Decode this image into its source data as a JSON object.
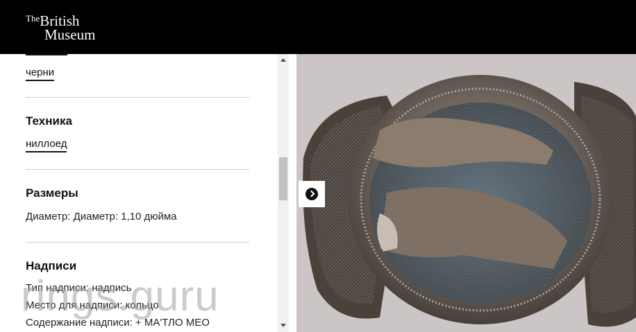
{
  "header": {
    "logo_the": "The",
    "logo_british": "British",
    "logo_museum": "Museum",
    "bg": "#000000"
  },
  "details": {
    "material_link": "черни",
    "technique_heading": "Техника",
    "technique_link": "ниллоед",
    "dimensions_heading": "Размеры",
    "dimensions_text": "Диаметр: Диаметр: 1,10 дюйма",
    "inscriptions_heading": "Надписи",
    "inscription_type": "Тип надписи: надпись",
    "inscription_place": "Место для надписи: кольцо",
    "inscription_content": "Содержание надписи: + МА'ТЛО МЕО"
  },
  "image": {
    "next_icon": "chevron-right-icon"
  },
  "watermark": {
    "text": "rings.guru"
  }
}
